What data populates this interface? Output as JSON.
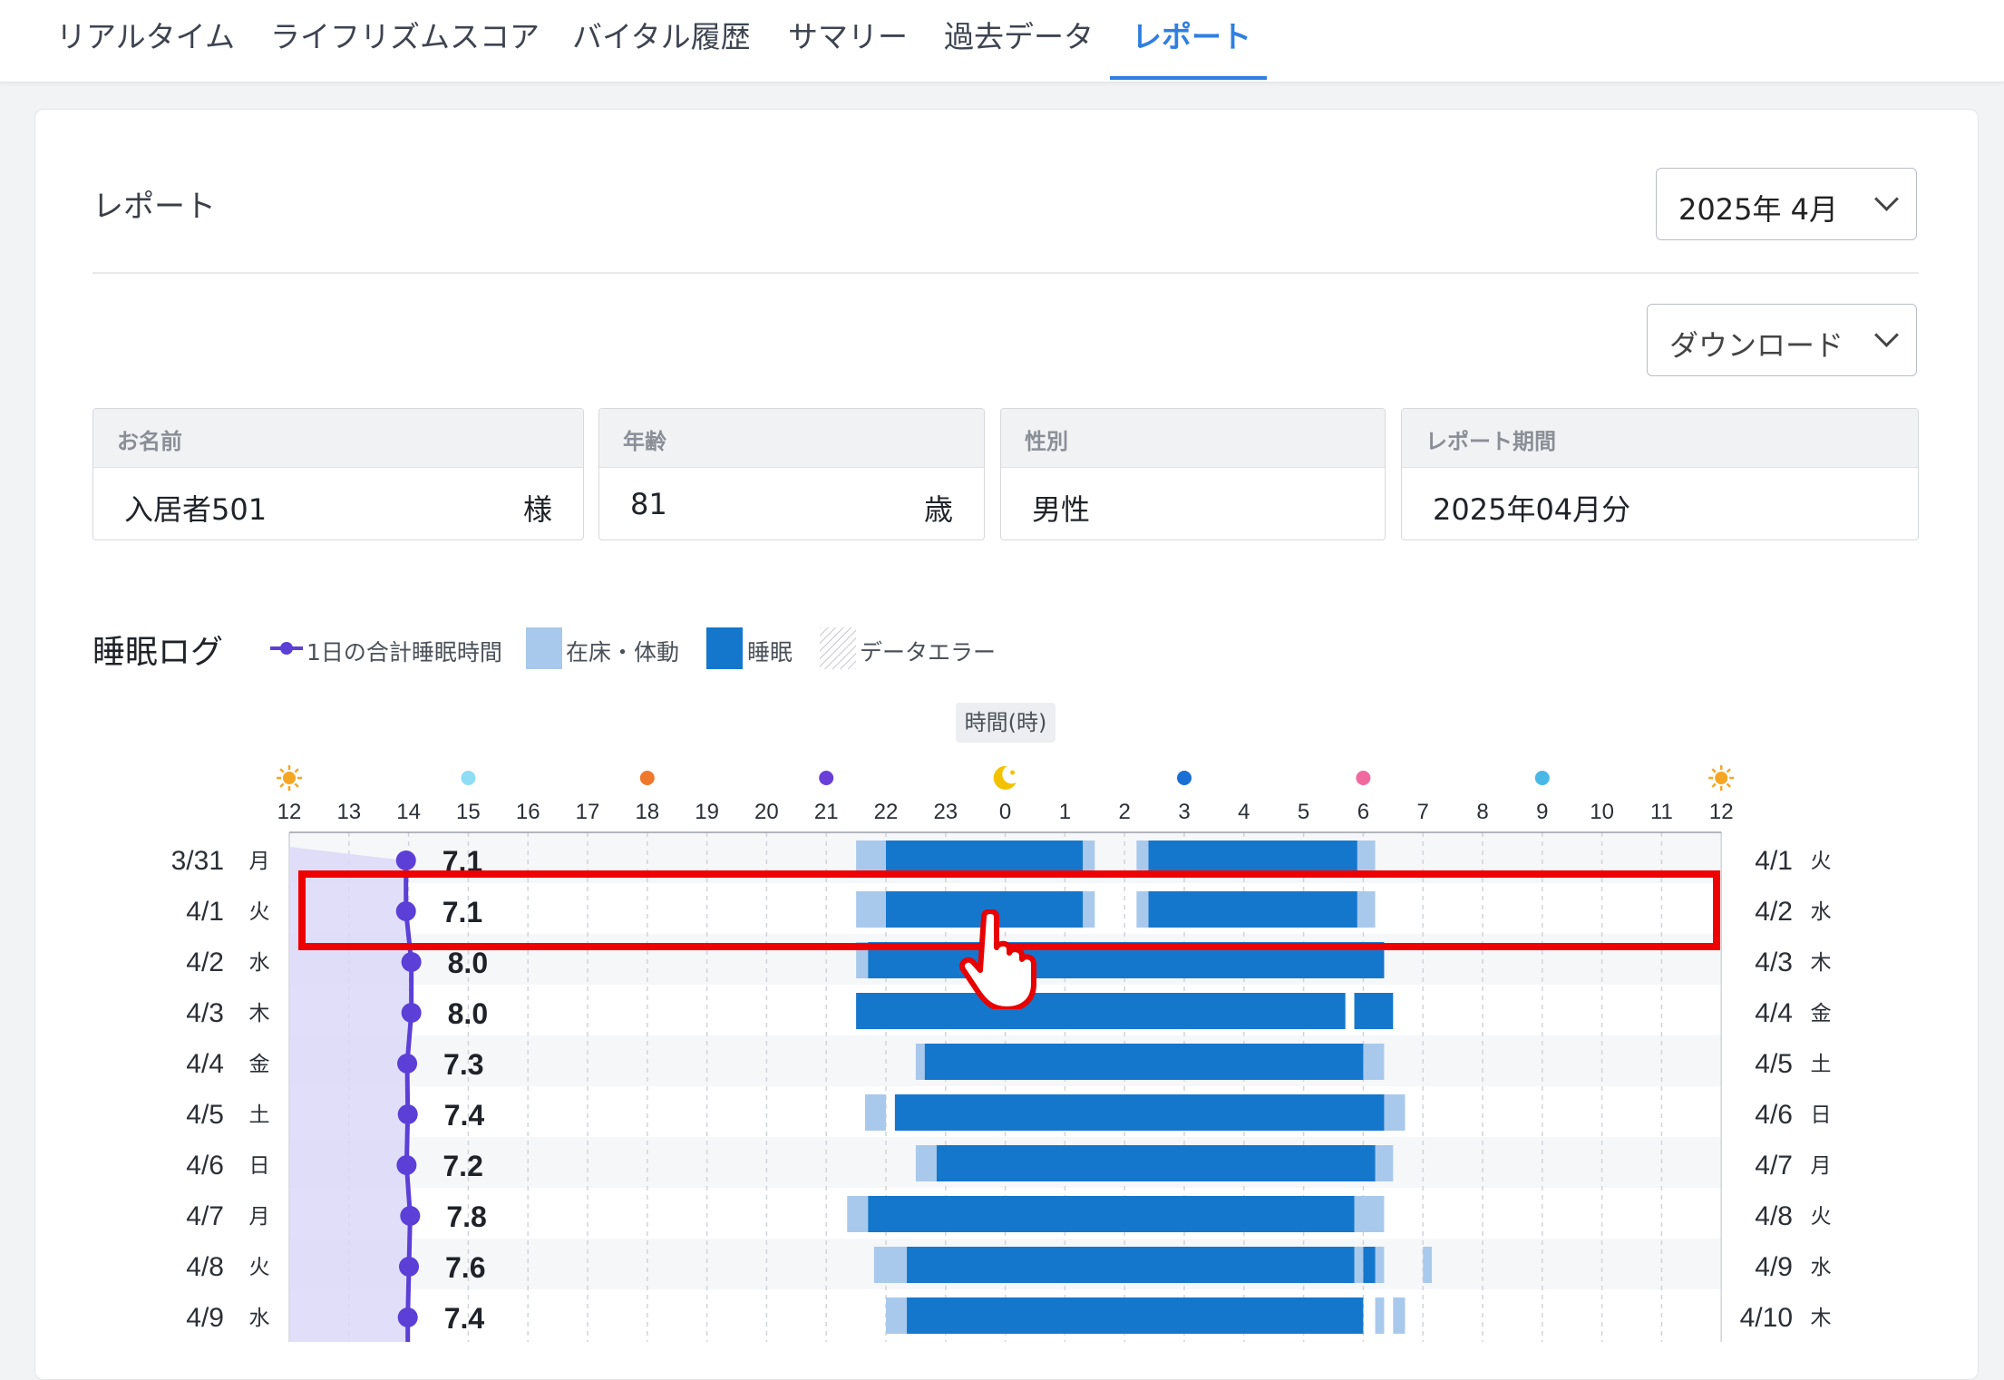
{
  "tabs": [
    {
      "label": "リアルタイム",
      "active": false
    },
    {
      "label": "ライフリズムスコア",
      "active": false
    },
    {
      "label": "バイタル履歴",
      "active": false
    },
    {
      "label": "サマリー",
      "active": false
    },
    {
      "label": "過去データ",
      "active": false
    },
    {
      "label": "レポート",
      "active": true
    }
  ],
  "page": {
    "title": "レポート",
    "month_value": "2025年 4月",
    "download_label": "ダウンロード"
  },
  "info": {
    "name": {
      "label": "お名前",
      "value": "入居者501",
      "unit": "様"
    },
    "age": {
      "label": "年齢",
      "value": "81",
      "unit": "歳"
    },
    "gender": {
      "label": "性別",
      "value": "男性"
    },
    "period": {
      "label": "レポート期間",
      "value": "2025年04月分"
    }
  },
  "legend": {
    "title": "睡眠ログ",
    "total": "1日の合計睡眠時間",
    "in_bed": "在床・体動",
    "sleep": "睡眠",
    "error": "データエラー"
  },
  "axis_unit_label": "時間(時)",
  "colors": {
    "accent": "#2f7fe0",
    "sleep": "#1577cc",
    "in_bed": "#a9c9ec",
    "total_line": "#5b3fd6",
    "total_fill": "#d9d6f7",
    "highlight": "#ee0000"
  },
  "chart_data": {
    "type": "bar",
    "x_ticks": [
      "12",
      "13",
      "14",
      "15",
      "16",
      "17",
      "18",
      "19",
      "20",
      "21",
      "22",
      "23",
      "0",
      "1",
      "2",
      "3",
      "4",
      "5",
      "6",
      "7",
      "8",
      "9",
      "10",
      "11",
      "12"
    ],
    "tick_icons": [
      {
        "hour_index": 0,
        "icon": "sun-icon",
        "color": "#f5a623"
      },
      {
        "hour_index": 3,
        "icon": "dot",
        "color": "#8fdcf5"
      },
      {
        "hour_index": 6,
        "icon": "dot",
        "color": "#f0782c"
      },
      {
        "hour_index": 9,
        "icon": "dot",
        "color": "#6a3fd8"
      },
      {
        "hour_index": 12,
        "icon": "moon-icon",
        "color": "#f2c200"
      },
      {
        "hour_index": 15,
        "icon": "dot",
        "color": "#1a6fd4"
      },
      {
        "hour_index": 18,
        "icon": "dot",
        "color": "#f06aa0"
      },
      {
        "hour_index": 21,
        "icon": "dot",
        "color": "#4ab8e6"
      },
      {
        "hour_index": 24,
        "icon": "sun-icon",
        "color": "#f5a623"
      }
    ],
    "rows": [
      {
        "date": "3/31",
        "dow": "月",
        "next_date": "4/1",
        "next_dow": "火",
        "total": "7.1",
        "total_h": 7.1,
        "in_bed": [
          [
            21.5,
            22.0
          ],
          [
            1.3,
            1.5
          ],
          [
            2.2,
            2.4
          ],
          [
            5.9,
            6.2
          ]
        ],
        "sleep": [
          [
            22.0,
            1.3
          ],
          [
            2.4,
            5.9
          ]
        ]
      },
      {
        "date": "4/1",
        "dow": "火",
        "next_date": "4/2",
        "next_dow": "水",
        "total": "7.1",
        "total_h": 7.1,
        "in_bed": [
          [
            21.5,
            22.0
          ],
          [
            1.3,
            1.5
          ],
          [
            2.2,
            2.4
          ],
          [
            5.9,
            6.2
          ]
        ],
        "sleep": [
          [
            22.0,
            1.3
          ],
          [
            2.4,
            5.9
          ]
        ]
      },
      {
        "date": "4/2",
        "dow": "水",
        "next_date": "4/3",
        "next_dow": "木",
        "total": "8.0",
        "total_h": 8.0,
        "in_bed": [
          [
            21.5,
            21.7
          ]
        ],
        "sleep": [
          [
            21.7,
            6.35
          ]
        ]
      },
      {
        "date": "4/3",
        "dow": "木",
        "next_date": "4/4",
        "next_dow": "金",
        "total": "8.0",
        "total_h": 8.0,
        "in_bed": [],
        "sleep": [
          [
            21.5,
            5.7
          ],
          [
            5.85,
            6.5
          ]
        ]
      },
      {
        "date": "4/4",
        "dow": "金",
        "next_date": "4/5",
        "next_dow": "土",
        "total": "7.3",
        "total_h": 7.3,
        "in_bed": [
          [
            22.5,
            22.65
          ],
          [
            6.0,
            6.35
          ]
        ],
        "sleep": [
          [
            22.65,
            6.0
          ]
        ]
      },
      {
        "date": "4/5",
        "dow": "土",
        "next_date": "4/6",
        "next_dow": "日",
        "total": "7.4",
        "total_h": 7.4,
        "in_bed": [
          [
            21.65,
            22.0
          ],
          [
            6.35,
            6.7
          ]
        ],
        "sleep": [
          [
            22.15,
            6.35
          ]
        ]
      },
      {
        "date": "4/6",
        "dow": "日",
        "next_date": "4/7",
        "next_dow": "月",
        "total": "7.2",
        "total_h": 7.2,
        "in_bed": [
          [
            22.5,
            22.85
          ],
          [
            6.2,
            6.5
          ]
        ],
        "sleep": [
          [
            22.85,
            6.2
          ]
        ]
      },
      {
        "date": "4/7",
        "dow": "月",
        "next_date": "4/8",
        "next_dow": "火",
        "total": "7.8",
        "total_h": 7.8,
        "in_bed": [
          [
            21.35,
            21.7
          ],
          [
            5.85,
            6.35
          ]
        ],
        "sleep": [
          [
            21.7,
            5.85
          ]
        ]
      },
      {
        "date": "4/8",
        "dow": "火",
        "next_date": "4/9",
        "next_dow": "水",
        "total": "7.6",
        "total_h": 7.6,
        "in_bed": [
          [
            21.8,
            22.35
          ],
          [
            5.85,
            6.0
          ],
          [
            6.2,
            6.35
          ],
          [
            7.0,
            7.15
          ]
        ],
        "sleep": [
          [
            22.35,
            5.85
          ],
          [
            6.0,
            6.2
          ]
        ]
      },
      {
        "date": "4/9",
        "dow": "水",
        "next_date": "4/10",
        "next_dow": "木",
        "total": "7.4",
        "total_h": 7.4,
        "in_bed": [
          [
            22.0,
            22.35
          ],
          [
            6.2,
            6.35
          ],
          [
            6.5,
            6.7
          ]
        ],
        "sleep": [
          [
            22.35,
            6.0
          ]
        ]
      }
    ]
  }
}
